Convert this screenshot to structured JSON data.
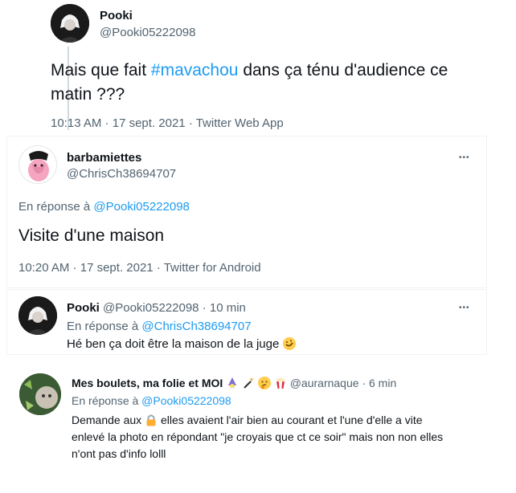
{
  "tweet1": {
    "name": "Pooki",
    "handle": "@Pooki05222098",
    "text_before": "Mais que fait ",
    "hashtag": "#mavachou",
    "text_after": " dans ça ténu d'audience ce",
    "text_line2": "matin ???",
    "time": "10:13 AM",
    "dot1": " · ",
    "date": "17 sept. 2021",
    "dot2": " · ",
    "source": "Twitter Web App"
  },
  "tweet2": {
    "name": "barbamiettes",
    "handle": "@ChrisCh38694707",
    "more": "•••",
    "reply_prefix": "En réponse à ",
    "reply_to": "@Pooki05222098",
    "text": "Visite d'une maison",
    "time": "10:20 AM",
    "dot1": " · ",
    "date": "17 sept. 2021",
    "dot2": " · ",
    "source": "Twitter for Android"
  },
  "tweet3": {
    "name": "Pooki",
    "handle": "@Pooki05222098",
    "sep": " · ",
    "age": "10 min",
    "more": "•••",
    "reply_prefix": "En réponse à ",
    "reply_to": "@ChrisCh38694707",
    "text": "Hé ben ça doit être la maison de la juge",
    "emoji": "rolling-on-floor-laughing-emoji"
  },
  "tweet4": {
    "name": "Mes boulets, ma folie et MOI",
    "emojis": [
      "mage-emoji",
      "magic-wand-emoji",
      "thinking-face-emoji",
      "popcorn-emoji"
    ],
    "handle": "@aurarnaque",
    "sep": " · ",
    "age": "6 min",
    "reply_prefix": "En réponse à ",
    "reply_to": "@Pooki05222098",
    "text_line1_a": "Demande aux ",
    "lock_icon": "lock-emoji",
    "text_line1_b": " elles avaient l'air bien au courant et l'une d'elle a vite",
    "text_line2": "enlevé la photo en répondant \"je croyais que ct ce soir\" mais non non elles",
    "text_line3": "n'ont pas d'info lolll"
  },
  "colors": {
    "link": "#1d9bf0",
    "muted": "#536471",
    "text": "#0f1419",
    "border": "#eff3f4",
    "thread_line": "#cfd9de"
  }
}
